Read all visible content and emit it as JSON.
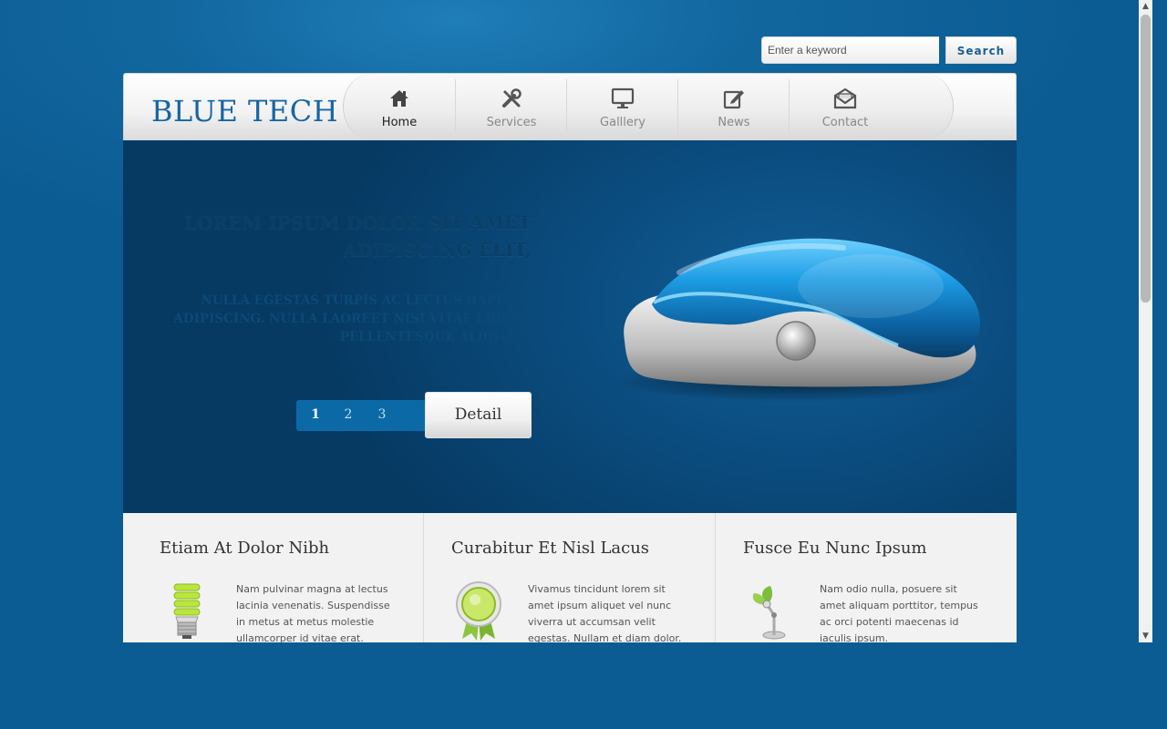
{
  "search": {
    "placeholder": "Enter a keyword",
    "button_label": "Search"
  },
  "header": {
    "logo": "BLUE TECH",
    "nav": [
      {
        "label": "Home",
        "icon": "home-icon",
        "active": true
      },
      {
        "label": "Services",
        "icon": "tools-icon",
        "active": false
      },
      {
        "label": "Galllery",
        "icon": "monitor-icon",
        "active": false
      },
      {
        "label": "News",
        "icon": "edit-icon",
        "active": false
      },
      {
        "label": "Contact",
        "icon": "envelope-icon",
        "active": false
      }
    ]
  },
  "hero": {
    "title": "LOREM IPSUM DOLOR SIT AMET ADIPISCING ELIT,",
    "text": "NULLA EGESTAS TURPIS AC LECTUS DAPIBUS ADIPISCING. NULLA LAOREET NISI VITAE LIBERO PELLENTESQUE ALIQUAM.",
    "pages": [
      "1",
      "2",
      "3"
    ],
    "current_page": "1",
    "detail_label": "Detail",
    "image": "computer-mouse-image"
  },
  "features": [
    {
      "title": "Etiam At Dolor Nibh",
      "icon": "light-bulb-icon",
      "text": "Nam pulvinar magna at lectus lacinia venenatis. Suspendisse in metus at metus molestie ullamcorper id vitae erat."
    },
    {
      "title": "Curabitur Et Nisl Lacus",
      "icon": "award-badge-icon",
      "text": "Vivamus tincidunt lorem sit amet ipsum aliquet vel nunc viverra ut accumsan velit egestas. Nullam et diam dolor."
    },
    {
      "title": "Fusce Eu Nunc Ipsum",
      "icon": "desk-lamp-icon",
      "text": "Nam odio nulla, posuere sit amet aliquam porttitor, tempus ac orci potenti maecenas id iaculis ipsum."
    }
  ],
  "colors": {
    "page_background": "#0b5c93",
    "logo": "#1565a4",
    "hero_dark": "#063a63",
    "accent": "#0b6aa6"
  }
}
